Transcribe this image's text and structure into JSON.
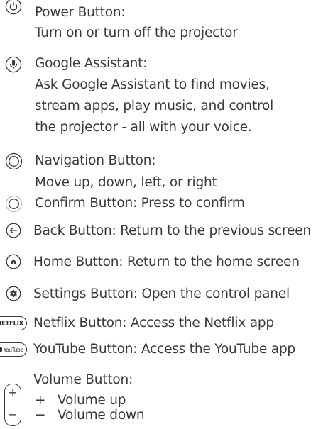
{
  "items": {
    "power": {
      "title": "Power Button:",
      "desc": "Turn on or turn off the projector"
    },
    "assistant": {
      "title": "Google Assistant:",
      "desc_lines": [
        "Ask Google Assistant to find movies,",
        "stream apps, play music, and control",
        "the projector - all with your voice."
      ]
    },
    "navigation": {
      "title": "Navigation Button:",
      "desc": "Move up, down, left, or right"
    },
    "confirm": {
      "text": "Confirm Button: Press to confirm"
    },
    "back": {
      "text": "Back Button: Return to the previous screen"
    },
    "home": {
      "text": "Home Button: Return to the home screen"
    },
    "settings": {
      "text": "Settings Button: Open the control panel"
    },
    "netflix": {
      "badge": "NETFLIX",
      "text": "Netflix Button: Access the Netflix app"
    },
    "youtube": {
      "badge": "YouTube",
      "text": "YouTube Button: Access the YouTube app"
    },
    "volume": {
      "title": "Volume Button:",
      "up_symbol": "+",
      "up_label": "Volume up",
      "down_symbol": "−",
      "down_label": "Volume down"
    }
  },
  "icons": {
    "power": "power-icon",
    "assistant": "microphone-icon",
    "navigation": "navigation-ring-icon",
    "confirm": "confirm-ring-icon",
    "back": "back-arrow-icon",
    "home": "home-icon",
    "settings": "gear-icon"
  }
}
